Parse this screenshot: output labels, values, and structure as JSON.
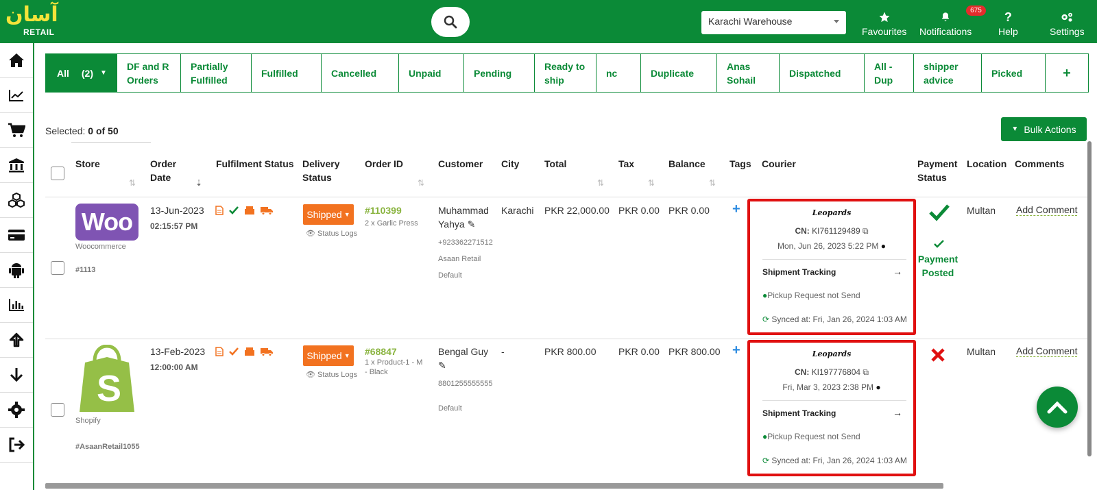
{
  "brand": {
    "arabic": "آسان",
    "english": "RETAIL"
  },
  "header": {
    "warehouse": "Karachi Warehouse",
    "nav": [
      {
        "label": "Favourites"
      },
      {
        "label": "Notifications",
        "badge": "675"
      },
      {
        "label": "Help"
      },
      {
        "label": "Settings"
      }
    ]
  },
  "tabs": [
    {
      "label": "All",
      "count": "(2)"
    },
    {
      "label": "DF and R Orders"
    },
    {
      "label": "Partially Fulfilled"
    },
    {
      "label": "Fulfilled"
    },
    {
      "label": "Cancelled"
    },
    {
      "label": "Unpaid"
    },
    {
      "label": "Pending"
    },
    {
      "label": "Ready to ship"
    },
    {
      "label": "nc"
    },
    {
      "label": "Duplicate"
    },
    {
      "label": "Anas Sohail"
    },
    {
      "label": "Dispatched"
    },
    {
      "label": "All - Dup"
    },
    {
      "label": "shipper advice"
    },
    {
      "label": "Picked"
    },
    {
      "label": "+"
    }
  ],
  "selection": {
    "label": "Selected:",
    "value": "0 of 50"
  },
  "bulk_actions": "Bulk Actions",
  "columns": {
    "store": "Store",
    "order_date": "Order Date",
    "fulfilment": "Fulfilment Status",
    "delivery": "Delivery Status",
    "order_id": "Order ID",
    "customer": "Customer",
    "city": "City",
    "total": "Total",
    "tax": "Tax",
    "balance": "Balance",
    "tags": "Tags",
    "courier": "Courier",
    "payment": "Payment Status",
    "location": "Location",
    "comments": "Comments"
  },
  "orders": [
    {
      "store_logo": "Woo",
      "store_name": "Woocommerce",
      "store_ref": "#1113",
      "date": "13-Jun-2023",
      "time": "02:15:57 PM",
      "delivery": "Shipped",
      "status_logs": "Status Logs",
      "order_id": "#110399",
      "items": "2 x Garlic Press",
      "customer_name": "Muhammad Yahya",
      "phone": "+923362271512",
      "company": "Asaan Retail",
      "customer_type": "Default",
      "city": "Karachi",
      "total": "PKR 22,000.00",
      "tax": "PKR 0.00",
      "balance": "PKR 0.00",
      "courier": {
        "brand": "Leopards",
        "cn_label": "CN:",
        "cn": "KI761129489",
        "date": "Mon, Jun 26, 2023 5:22 PM",
        "tracking": "Shipment Tracking",
        "pickup": "Pickup Request not Send",
        "synced": "Synced at: Fri, Jan 26, 2024 1:03 AM"
      },
      "payment": "Payment Posted",
      "location": "Multan",
      "comment": "Add Comment"
    },
    {
      "store_logo": "S",
      "store_name": "Shopify",
      "store_ref": "#AsaanRetail1055",
      "date": "13-Feb-2023",
      "time": "12:00:00 AM",
      "delivery": "Shipped",
      "status_logs": "Status Logs",
      "order_id": "#68847",
      "items": "1 x Product-1 - M - Black",
      "customer_name": "Bengal Guy",
      "phone": "8801255555555",
      "company": "",
      "customer_type": "Default",
      "city": "-",
      "total": "PKR 800.00",
      "tax": "PKR 0.00",
      "balance": "PKR 800.00",
      "courier": {
        "brand": "Leopards",
        "cn_label": "CN:",
        "cn": "KI197776804",
        "date": "Fri, Mar 3, 2023 2:38 PM",
        "tracking": "Shipment Tracking",
        "pickup": "Pickup Request not Send",
        "synced": "Synced at: Fri, Jan 26, 2024 1:03 AM"
      },
      "payment": "",
      "location": "Multan",
      "comment": "Add Comment"
    }
  ],
  "colors": {
    "brand_green": "#0b8a37",
    "accent_orange": "#f27220",
    "alert_red": "#e01010",
    "link_green": "#8ab440"
  }
}
